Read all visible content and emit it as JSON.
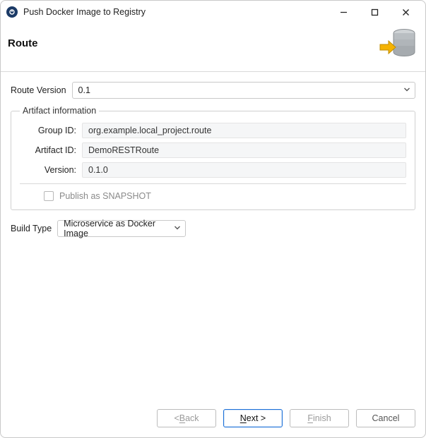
{
  "titlebar": {
    "title": "Push Docker Image to Registry"
  },
  "header": {
    "title": "Route"
  },
  "routeVersion": {
    "label": "Route Version",
    "value": "0.1"
  },
  "artifact": {
    "legend": "Artifact information",
    "groupId": {
      "label": "Group ID:",
      "value": "org.example.local_project.route"
    },
    "artifactId": {
      "label": "Artifact ID:",
      "value": "DemoRESTRoute"
    },
    "version": {
      "label": "Version:",
      "value": "0.1.0"
    },
    "publishSnapshot": {
      "label": "Publish as SNAPSHOT",
      "checked": false
    }
  },
  "buildType": {
    "label": "Build Type",
    "value": "Microservice as Docker Image"
  },
  "buttons": {
    "back": {
      "prefix": "< ",
      "mn": "B",
      "rest": "ack"
    },
    "next": {
      "mn": "N",
      "rest": "ext >"
    },
    "finish": {
      "mn": "F",
      "rest": "inish"
    },
    "cancel": {
      "label": "Cancel"
    }
  }
}
